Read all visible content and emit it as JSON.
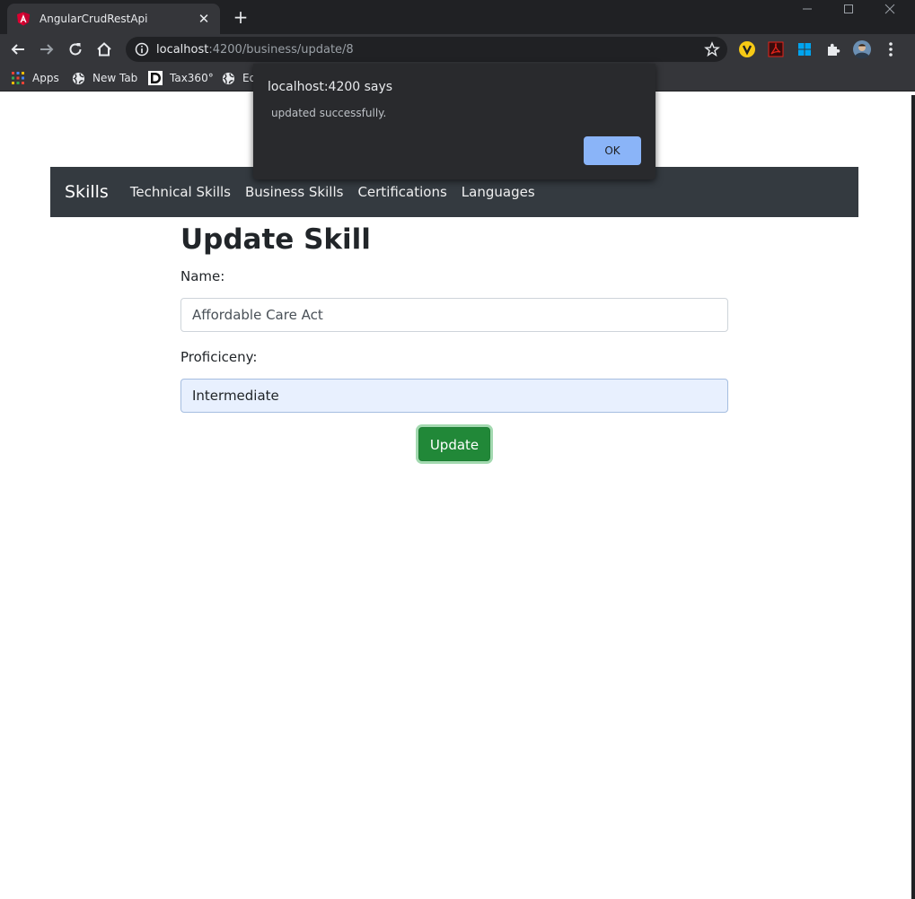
{
  "browser": {
    "tab_title": "AngularCrudRestApi",
    "tab_close": "✕",
    "new_tab": "+",
    "url_host": "localhost",
    "url_rest": ":4200/business/update/8"
  },
  "bookmarks": {
    "items": [
      {
        "label": "Apps",
        "icon": "apps-grid-icon"
      },
      {
        "label": "New Tab",
        "icon": "globe-icon"
      },
      {
        "label": "Tax360°",
        "icon": "d-logo-icon"
      },
      {
        "label": "Ed",
        "icon": "globe-icon"
      }
    ]
  },
  "navbar": {
    "brand": "Skills",
    "links": [
      "Technical Skills",
      "Business Skills",
      "Certifications",
      "Languages"
    ]
  },
  "form": {
    "title": "Update Skill",
    "name_label": "Name:",
    "name_value": "Affordable Care Act",
    "proficiency_label": "Proficiceny:",
    "proficiency_value": "Intermediate",
    "submit_label": "Update"
  },
  "dialog": {
    "title": "localhost:4200 says",
    "message": "updated successfully.",
    "ok_label": "OK"
  },
  "colors": {
    "navbar_bg": "#343a40",
    "button_bg": "#218838",
    "dialog_bg": "#292a2d",
    "ok_bg": "#8ab4f8",
    "autofill_bg": "#e8f0fe"
  }
}
